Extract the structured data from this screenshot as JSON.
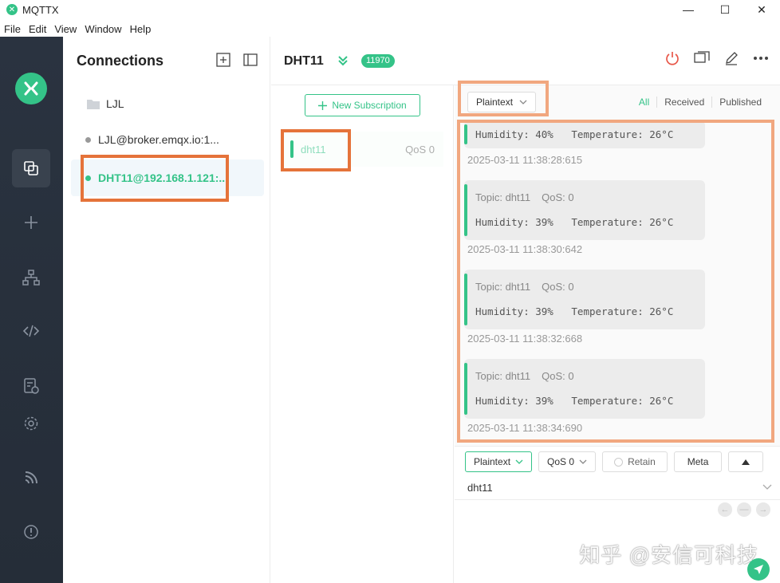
{
  "window": {
    "title": "MQTTX",
    "minimize": "—",
    "maximize": "☐",
    "close": "✕"
  },
  "menu": [
    "File",
    "Edit",
    "View",
    "Window",
    "Help"
  ],
  "connections": {
    "header": "Connections",
    "folder": "LJL",
    "items": [
      {
        "label": "LJL@broker.emqx.io:1...",
        "status": "offline"
      },
      {
        "label": "DHT11@192.168.1.121:...",
        "status": "online"
      }
    ]
  },
  "main": {
    "connection_name": "DHT11",
    "message_count": "11970"
  },
  "subscriptions": {
    "new_button": "New Subscription",
    "items": [
      {
        "topic": "dht11",
        "qos": "QoS 0"
      }
    ]
  },
  "messages": {
    "format": "Plaintext",
    "tabs": [
      "All",
      "Received",
      "Published"
    ],
    "list": [
      {
        "topic": "",
        "qos": "",
        "payload": "Humidity: 40%   Temperature: 26°C",
        "time": "2025-03-11 11:38:28:615"
      },
      {
        "topic": "Topic: dht11",
        "qos": "QoS: 0",
        "payload": "Humidity: 39%   Temperature: 26°C",
        "time": "2025-03-11 11:38:30:642"
      },
      {
        "topic": "Topic: dht11",
        "qos": "QoS: 0",
        "payload": "Humidity: 39%   Temperature: 26°C",
        "time": "2025-03-11 11:38:32:668"
      },
      {
        "topic": "Topic: dht11",
        "qos": "QoS: 0",
        "payload": "Humidity: 39%   Temperature: 26°C",
        "time": "2025-03-11 11:38:34:690"
      }
    ]
  },
  "publish": {
    "format": "Plaintext",
    "qos": "QoS 0",
    "retain": "Retain",
    "meta": "Meta",
    "topic": "dht11"
  },
  "watermark": "知乎 @安信可科技",
  "colors": {
    "accent": "#34c388",
    "sidebar": "#2a3340",
    "highlight": "#e5733a"
  }
}
